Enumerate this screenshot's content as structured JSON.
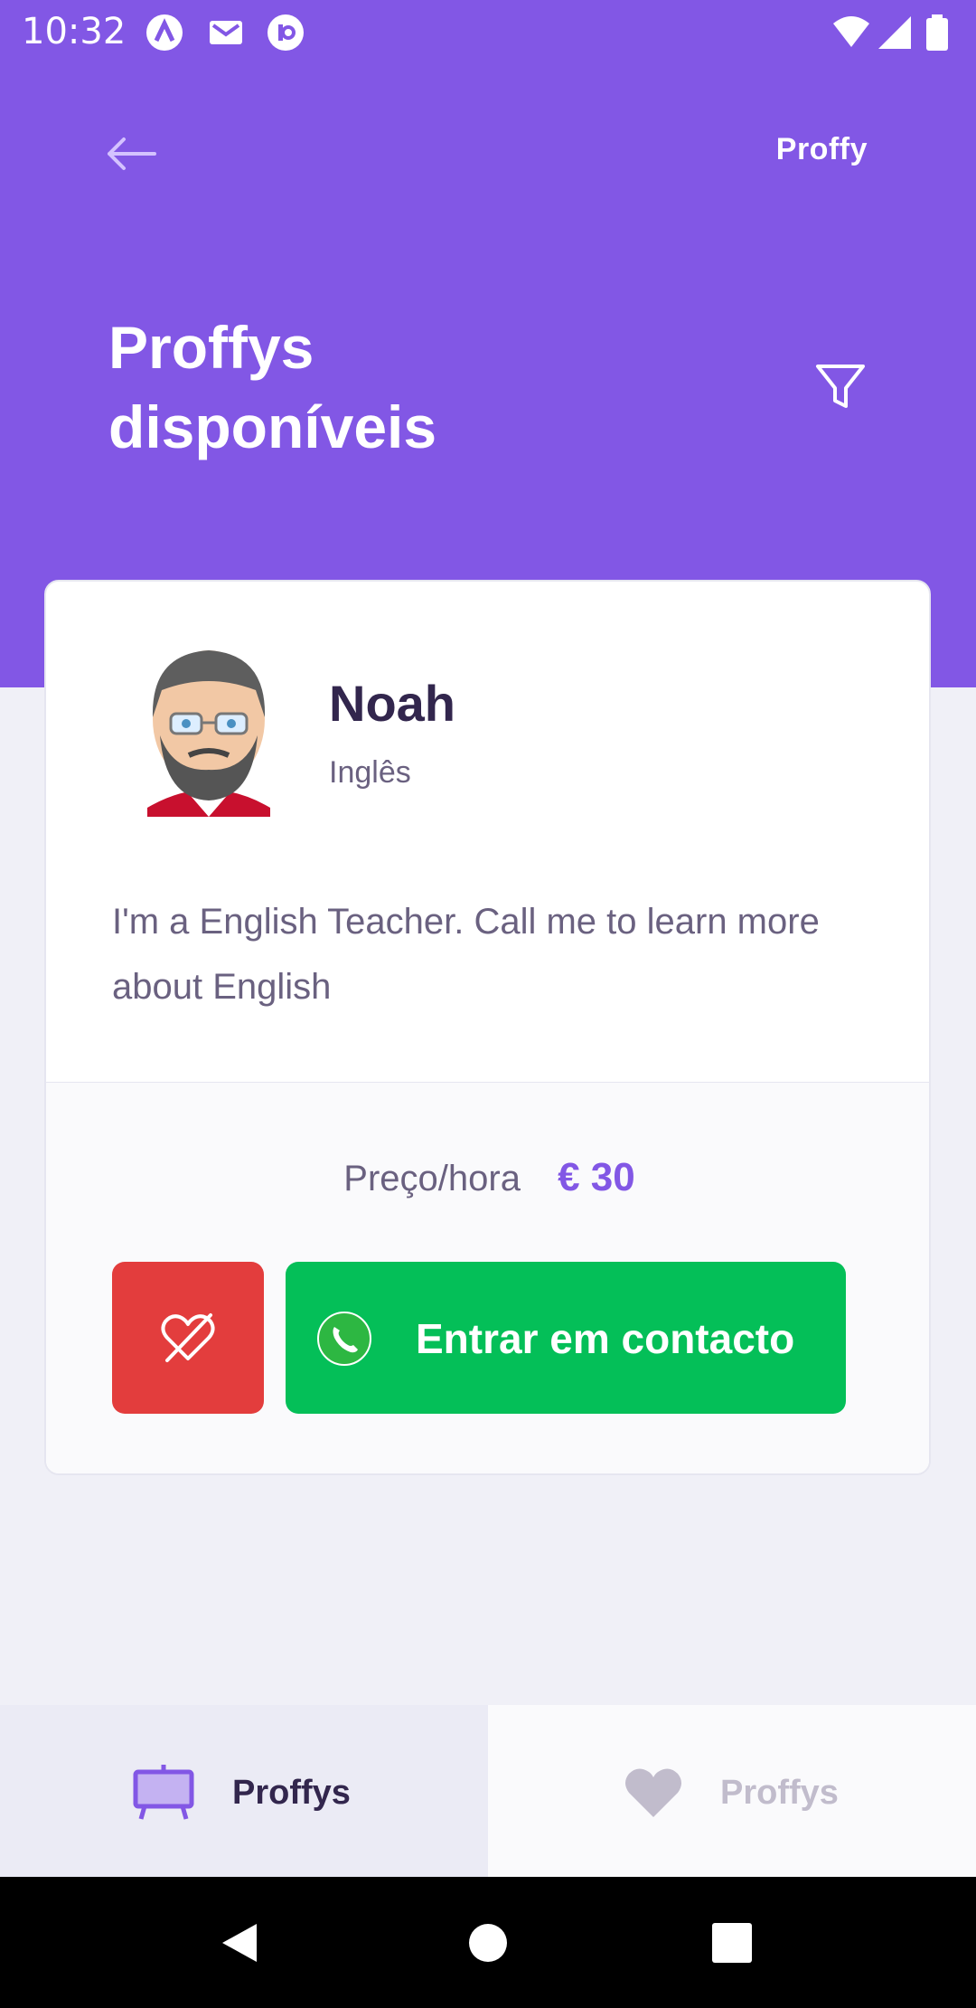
{
  "status_bar": {
    "time": "10:32",
    "icons": [
      "a-logo-icon",
      "mail-icon",
      "notification-icon",
      "wifi-icon",
      "signal-icon",
      "battery-icon"
    ]
  },
  "header": {
    "brand": "Proffy",
    "title_line1": "Proffys",
    "title_line2": "disponíveis",
    "back_icon": "arrow-left-icon",
    "filter_icon": "filter-icon"
  },
  "teacher_card": {
    "name": "Noah",
    "subject": "Inglês",
    "bio": "I'm a English Teacher. Call me to learn more about English",
    "price_label": "Preço/hora",
    "price_value": "€ 30",
    "unfavorite_icon": "heart-off-icon",
    "contact_icon": "whatsapp-icon",
    "contact_label": "Entrar em contacto"
  },
  "tabs": [
    {
      "label": "Proffys",
      "icon": "easel-icon",
      "active": true
    },
    {
      "label": "Proffys",
      "icon": "heart-icon",
      "active": false
    }
  ],
  "nav_bar": [
    "back-triangle-icon",
    "home-circle-icon",
    "recents-square-icon"
  ],
  "colors": {
    "primary": "#8257E5",
    "background": "#F0F0F7",
    "title_dark": "#32264D",
    "text": "#6A6180",
    "danger": "#E33D3D",
    "success": "#04BF58"
  }
}
